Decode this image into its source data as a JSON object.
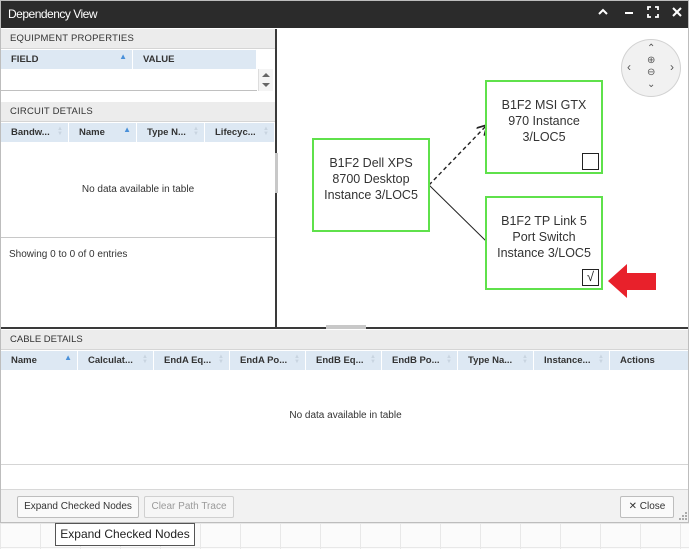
{
  "window": {
    "title": "Dependency View",
    "controls": [
      "collapse",
      "minimize",
      "maximize",
      "close"
    ]
  },
  "equipment_properties": {
    "header": "EQUIPMENT PROPERTIES",
    "columns": [
      "FIELD",
      "VALUE"
    ]
  },
  "circuit_details": {
    "header": "CIRCUIT DETAILS",
    "columns": [
      "Bandw...",
      "Name",
      "Type N...",
      "Lifecyc..."
    ],
    "empty_message": "No data available in table",
    "info": "Showing 0 to 0 of 0 entries"
  },
  "graph": {
    "nodes": [
      {
        "label": "B1F2 Dell XPS 8700 Desktop Instance 3/LOC5",
        "checked": false,
        "has_checkbox": false
      },
      {
        "label": "B1F2 MSI GTX 970 Instance 3/LOC5",
        "checked": false,
        "has_checkbox": true
      },
      {
        "label": "B1F2 TP Link 5 Port Switch Instance 3/LOC5",
        "checked": true,
        "has_checkbox": true
      }
    ],
    "arrow_color": "#e8212b",
    "node_border_color": "#5fe14b",
    "nav_icons": [
      "pan-up-icon",
      "pan-down-icon",
      "pan-left-icon",
      "pan-right-icon",
      "zoom-in-icon",
      "zoom-out-icon"
    ]
  },
  "cable_details": {
    "header": "CABLE DETAILS",
    "columns": [
      "Name",
      "Calculat...",
      "EndA Eq...",
      "EndA Po...",
      "EndB Eq...",
      "EndB Po...",
      "Type Na...",
      "Instance...",
      "Actions"
    ],
    "empty_message": "No data available in table"
  },
  "footer": {
    "expand_label": "Expand Checked Nodes",
    "clear_label": "Clear Path Trace",
    "close_label": "Close"
  },
  "tooltip": {
    "text": "Expand Checked Nodes"
  }
}
